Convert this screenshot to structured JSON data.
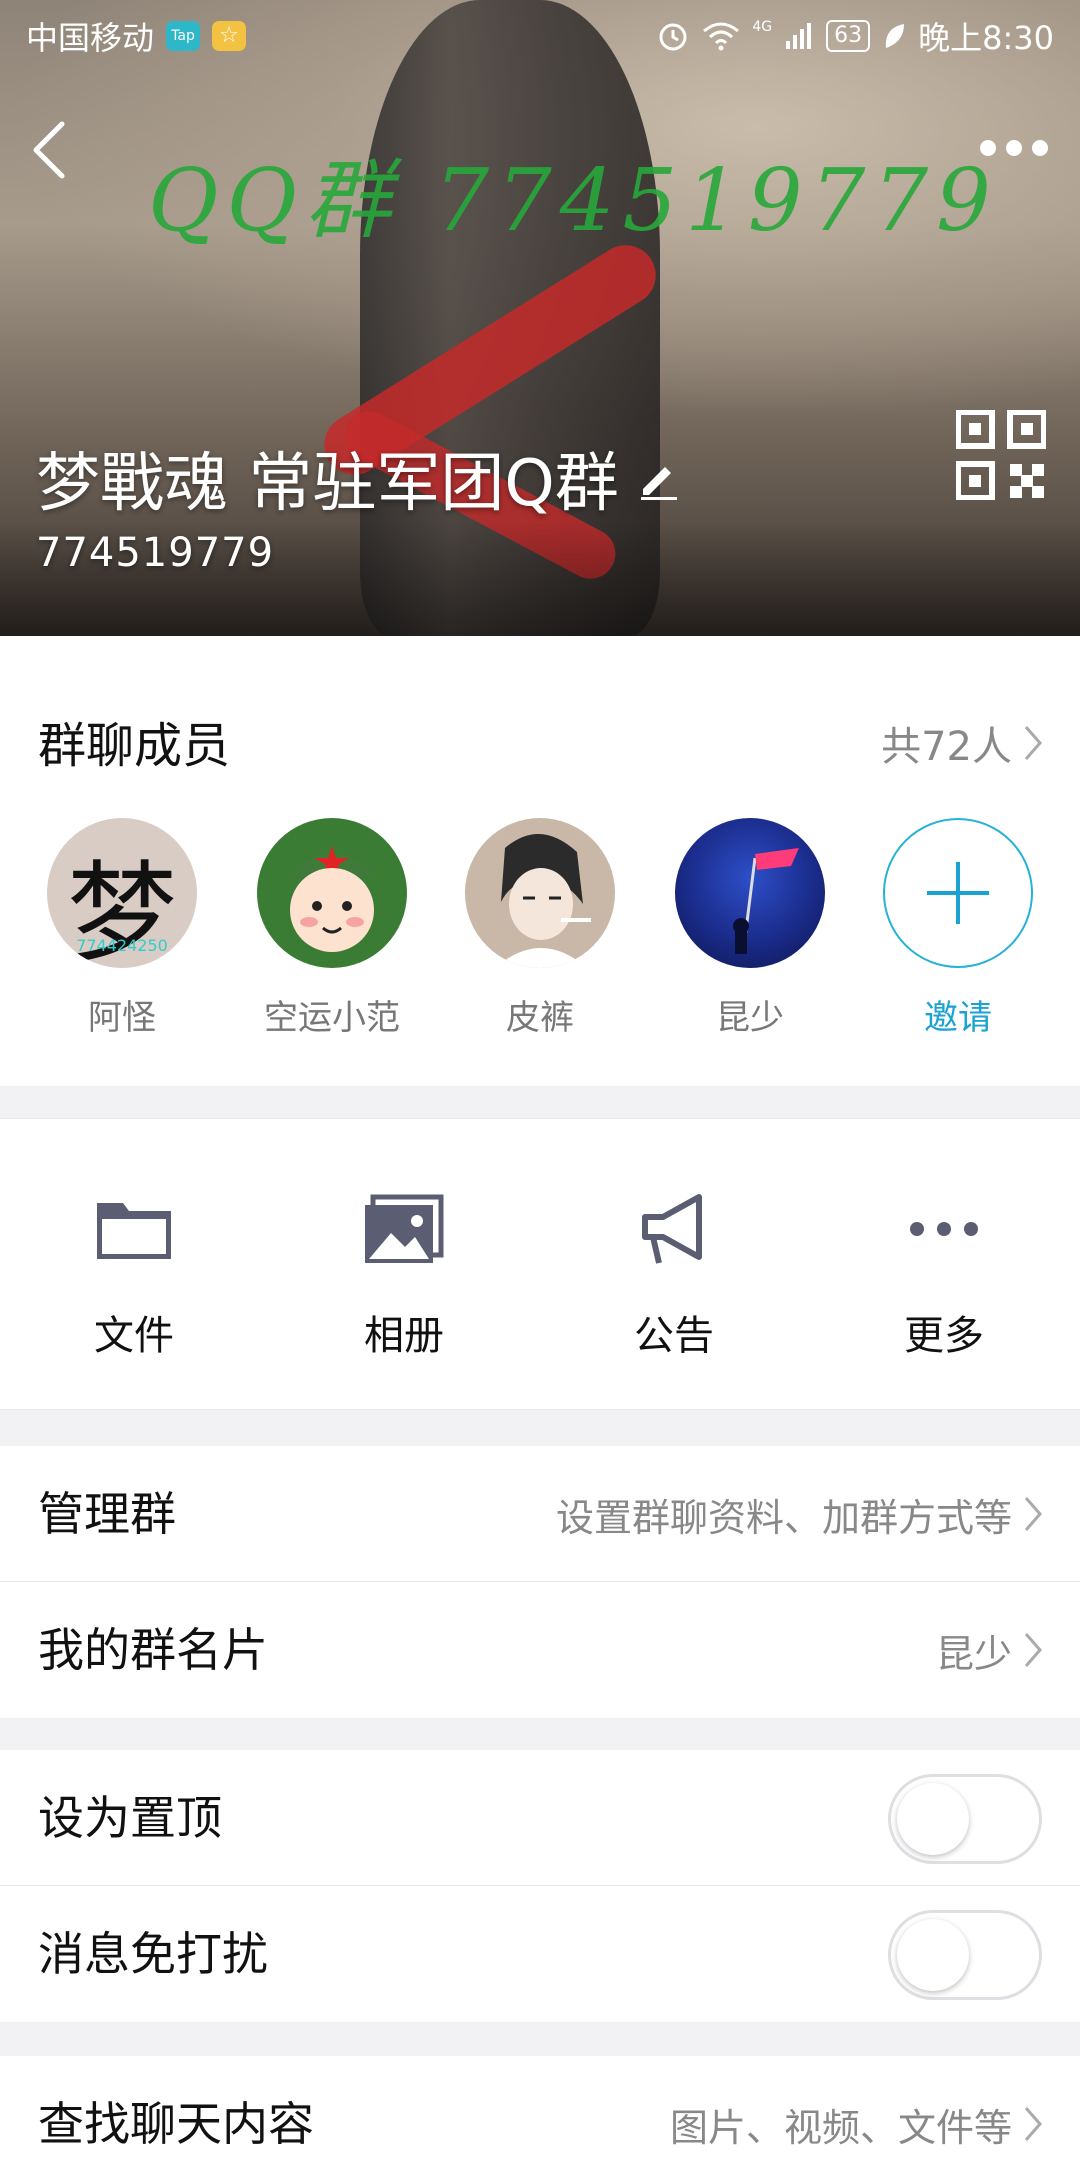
{
  "status_bar": {
    "carrier": "中国移动",
    "tap_badge": "Tap",
    "star_badge": "☆",
    "battery": "63",
    "time": "晚上8:30",
    "network": "4G"
  },
  "header": {
    "watermark": "QQ群 774519779",
    "group_name": "梦戰魂  常驻军团Q群",
    "group_id": "774519779"
  },
  "members": {
    "title": "群聊成员",
    "count": "共72人",
    "list": [
      {
        "name": "阿怪",
        "avatar_glyph": "梦",
        "avatar_number": "774424250"
      },
      {
        "name": "空运小范"
      },
      {
        "name": "皮裤"
      },
      {
        "name": "昆少"
      }
    ],
    "invite_label": "邀请"
  },
  "tools": [
    {
      "label": "文件",
      "icon": "folder-icon"
    },
    {
      "label": "相册",
      "icon": "album-icon"
    },
    {
      "label": "公告",
      "icon": "megaphone-icon"
    },
    {
      "label": "更多",
      "icon": "more-icon"
    }
  ],
  "rows": {
    "manage": {
      "label": "管理群",
      "value": "设置群聊资料、加群方式等"
    },
    "card": {
      "label": "我的群名片",
      "value": "昆少"
    },
    "pin": {
      "label": "设为置顶",
      "on": false
    },
    "mute": {
      "label": "消息免打扰",
      "on": false
    },
    "search": {
      "label": "查找聊天内容",
      "value": "图片、视频、文件等"
    }
  },
  "colors": {
    "accent": "#1aa2d2",
    "watermark": "#27a83a",
    "icon_gray": "#5b5e72"
  }
}
